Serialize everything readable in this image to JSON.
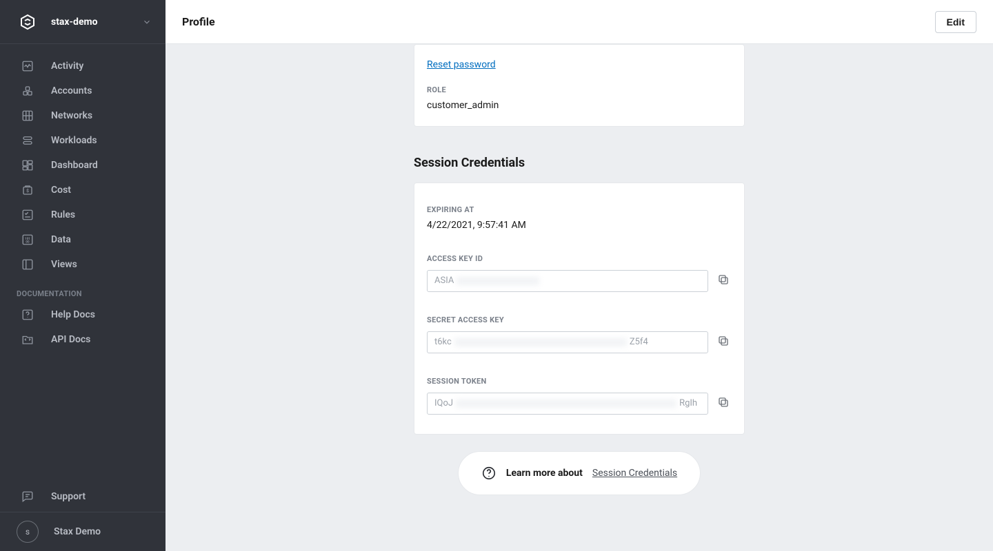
{
  "sidebar": {
    "org_name": "stax-demo",
    "items": [
      {
        "label": "Activity"
      },
      {
        "label": "Accounts"
      },
      {
        "label": "Networks"
      },
      {
        "label": "Workloads"
      },
      {
        "label": "Dashboard"
      },
      {
        "label": "Cost"
      },
      {
        "label": "Rules"
      },
      {
        "label": "Data"
      },
      {
        "label": "Views"
      }
    ],
    "docs_heading": "DOCUMENTATION",
    "docs": [
      {
        "label": "Help Docs"
      },
      {
        "label": "API Docs"
      }
    ],
    "support_label": "Support",
    "user": {
      "initial": "s",
      "name": "Stax Demo"
    }
  },
  "header": {
    "title": "Profile",
    "edit_label": "Edit"
  },
  "profile": {
    "reset_link": "Reset password",
    "role_label": "Role",
    "role_value": "customer_admin"
  },
  "session": {
    "heading": "Session Credentials",
    "expiring_label": "Expiring At",
    "expiring_value": "4/22/2021, 9:57:41 AM",
    "access_key_label": "Access Key ID",
    "access_key_prefix": "ASIA",
    "secret_key_label": "Secret Access Key",
    "secret_key_prefix": "t6kc",
    "secret_key_suffix": "Z5f4",
    "session_token_label": "Session Token",
    "session_token_prefix": "IQoJ",
    "session_token_suffix": "RgIh"
  },
  "learn": {
    "text": "Learn more about",
    "link": "Session Credentials"
  }
}
